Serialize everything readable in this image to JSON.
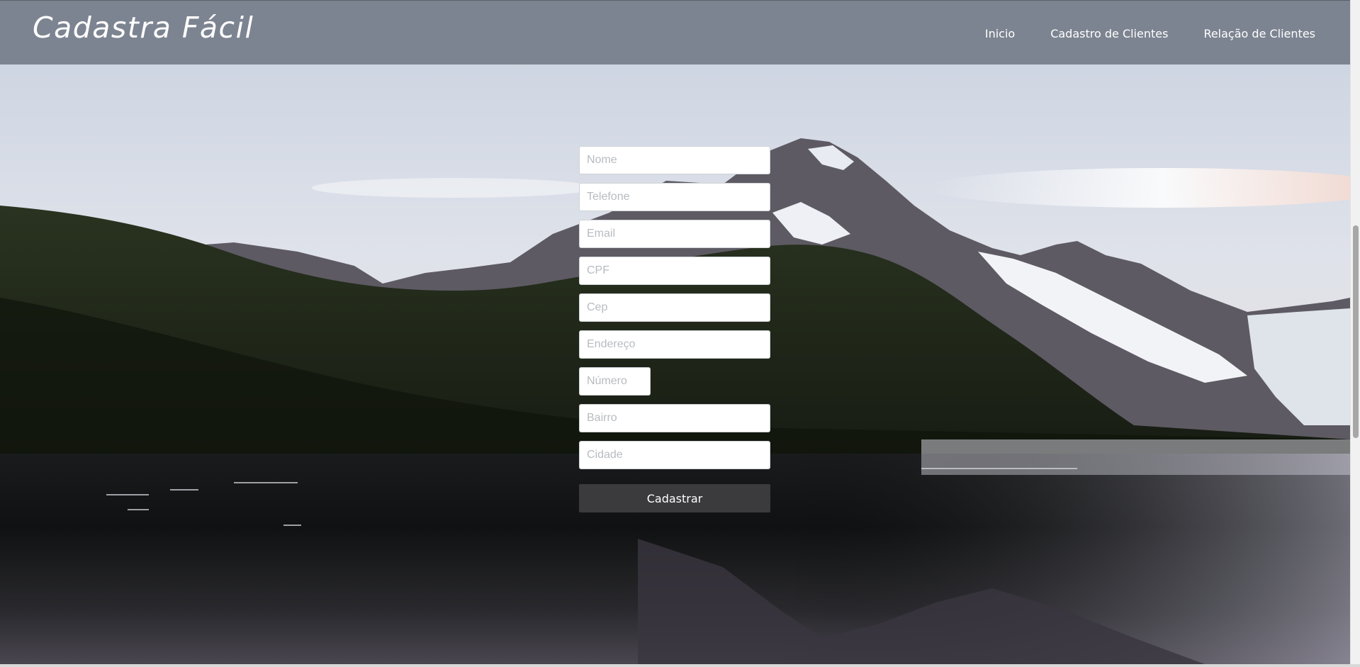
{
  "header": {
    "brand": "Cadastra Fácil",
    "nav": [
      {
        "label": "Inicio"
      },
      {
        "label": "Cadastro de Clientes"
      },
      {
        "label": "Relação de Clientes"
      }
    ]
  },
  "form": {
    "fields": {
      "nome": {
        "placeholder": "Nome",
        "value": ""
      },
      "telefone": {
        "placeholder": "Telefone",
        "value": ""
      },
      "email": {
        "placeholder": "Email",
        "value": ""
      },
      "cpf": {
        "placeholder": "CPF",
        "value": ""
      },
      "cep": {
        "placeholder": "Cep",
        "value": ""
      },
      "endereco": {
        "placeholder": "Endereço",
        "value": ""
      },
      "numero": {
        "placeholder": "Número",
        "value": ""
      },
      "bairro": {
        "placeholder": "Bairro",
        "value": ""
      },
      "cidade": {
        "placeholder": "Cidade",
        "value": ""
      }
    },
    "submit_label": "Cadastrar"
  },
  "colors": {
    "header_bg": "#78808c",
    "button_bg": "#3b3b3d",
    "placeholder": "#b7bcc0"
  },
  "icons": {
    "background": "mountain-lake-landscape"
  }
}
